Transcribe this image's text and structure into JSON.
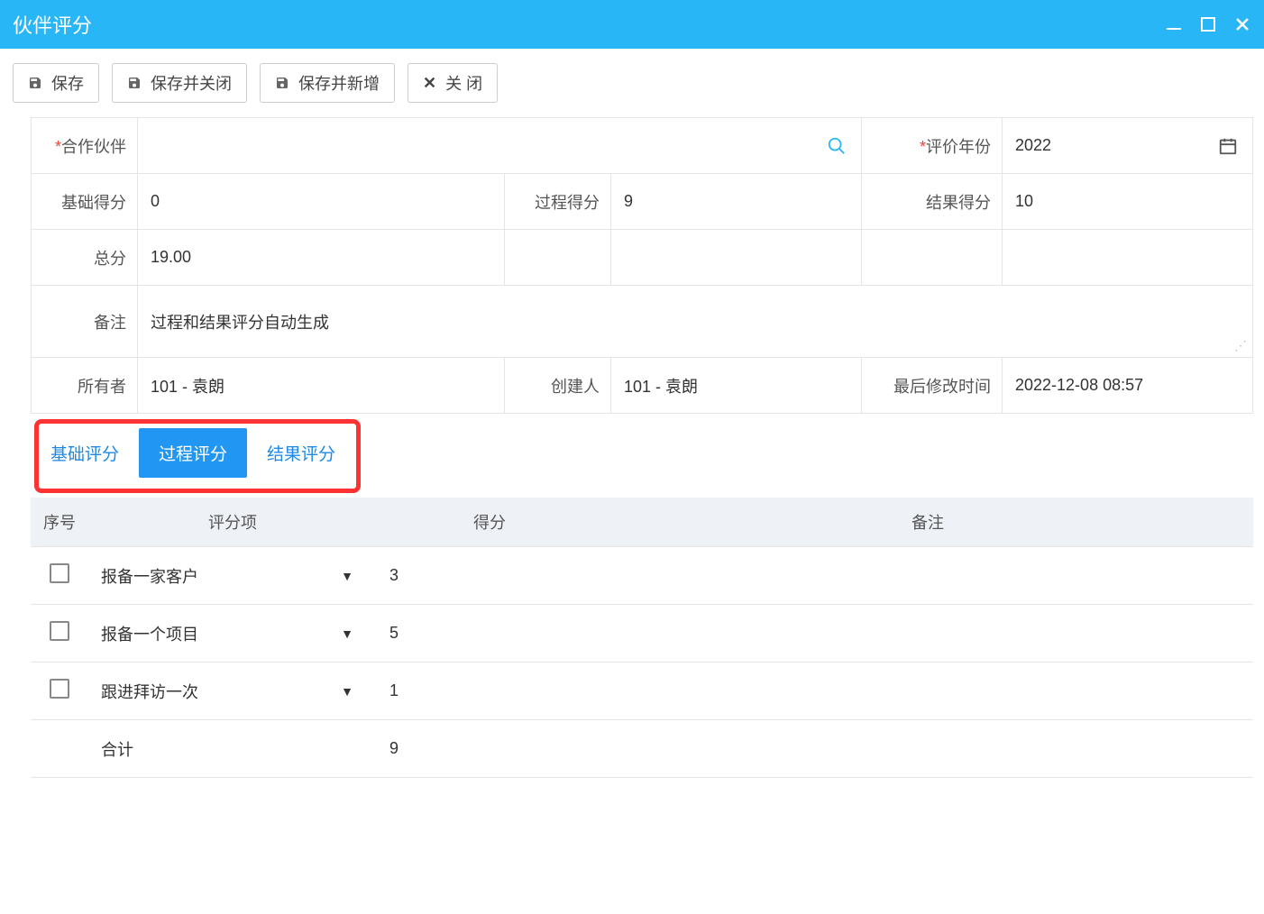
{
  "window": {
    "title": "伙伴评分"
  },
  "toolbar": {
    "save": "保存",
    "save_close": "保存并关闭",
    "save_new": "保存并新增",
    "close": "关 闭"
  },
  "form": {
    "partner_label": "合作伙伴",
    "partner_value": "",
    "year_label": "评价年份",
    "year_value": "2022",
    "base_score_label": "基础得分",
    "base_score_value": "0",
    "process_score_label": "过程得分",
    "process_score_value": "9",
    "result_score_label": "结果得分",
    "result_score_value": "10",
    "total_label": "总分",
    "total_value": "19.00",
    "remark_label": "备注",
    "remark_value": "过程和结果评分自动生成",
    "owner_label": "所有者",
    "owner_value": "101 - 袁朗",
    "creator_label": "创建人",
    "creator_value": "101 - 袁朗",
    "modified_label": "最后修改时间",
    "modified_value": "2022-12-08 08:57"
  },
  "tabs": {
    "base": "基础评分",
    "process": "过程评分",
    "result": "结果评分",
    "active": "process"
  },
  "grid": {
    "headers": {
      "seq": "序号",
      "item": "评分项",
      "score": "得分",
      "remark": "备注"
    },
    "rows": [
      {
        "item": "报备一家客户",
        "score": "3",
        "remark": ""
      },
      {
        "item": "报备一个项目",
        "score": "5",
        "remark": ""
      },
      {
        "item": "跟进拜访一次",
        "score": "1",
        "remark": ""
      }
    ],
    "footer": {
      "label": "合计",
      "total": "9"
    }
  }
}
